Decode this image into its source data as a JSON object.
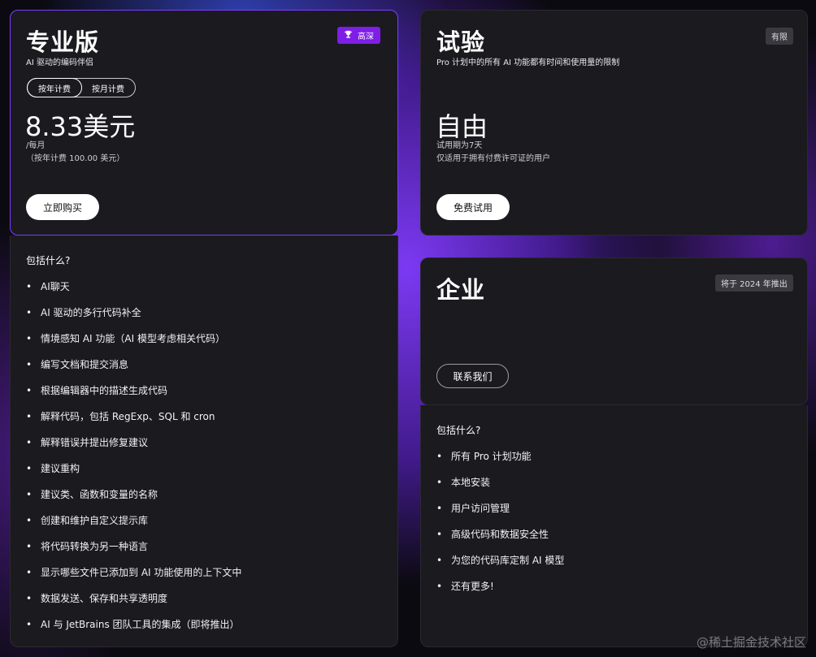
{
  "pro": {
    "title": "专业版",
    "subtitle": "AI 驱动的编码伴侣",
    "badge": "高深",
    "badge_icon": "trophy-icon",
    "toggle": {
      "yearly": "按年计费",
      "monthly": "按月计费",
      "selected": "yearly"
    },
    "price": "8.33美元",
    "per_month": "/每月",
    "yearly_note": "（按年计费 100.00 美元）",
    "buy_button": "立即购买",
    "features_heading": "包括什么?",
    "features": [
      "AI聊天",
      "AI 驱动的多行代码补全",
      "情境感知 AI 功能（AI 模型考虑相关代码）",
      "编写文档和提交消息",
      "根据编辑器中的描述生成代码",
      "解释代码，包括 RegExp、SQL 和 cron",
      "解释错误并提出修复建议",
      "建议重构",
      "建议类、函数和变量的名称",
      "创建和维护自定义提示库",
      "将代码转换为另一种语言",
      "显示哪些文件已添加到 AI 功能使用的上下文中",
      "数据发送、保存和共享透明度",
      "AI 与 JetBrains 团队工具的集成（即将推出）"
    ]
  },
  "trial": {
    "title": "试验",
    "badge": "有限",
    "subtitle": "Pro 计划中的所有 AI 功能都有时间和使用量的限制",
    "price": "自由",
    "period": "试用期为7天",
    "note": "仅适用于拥有付费许可证的用户",
    "button": "免费试用"
  },
  "enterprise": {
    "title": "企业",
    "badge": "将于 2024 年推出",
    "button": "联系我们",
    "features_heading": "包括什么?",
    "features": [
      "所有 Pro 计划功能",
      "本地安装",
      "用户访问管理",
      "高级代码和数据安全性",
      "为您的代码库定制 AI 模型",
      "还有更多!"
    ]
  },
  "watermark": "@稀土掘金技术社区",
  "colors": {
    "accent": "#7e1ee6",
    "card": "#1b1a1f",
    "border_selected": "#7a3dff"
  }
}
